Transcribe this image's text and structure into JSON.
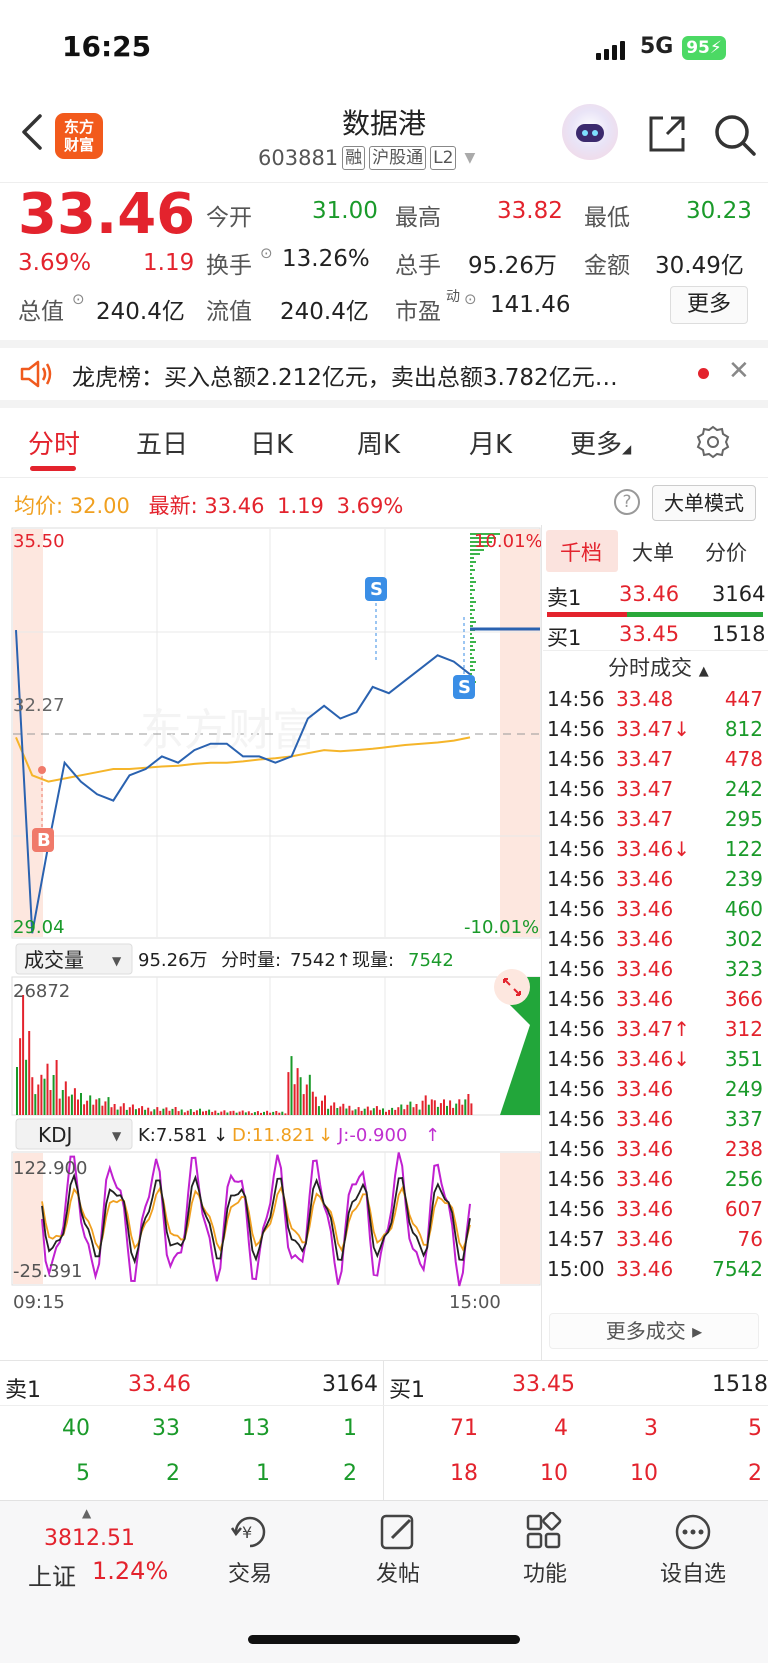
{
  "status": {
    "time": "16:25",
    "network": "5G",
    "battery": "95"
  },
  "header": {
    "logo_text_1": "东方",
    "logo_text_2": "财富",
    "name": "数据港",
    "code": "603881",
    "tags": [
      "融",
      "沪股通",
      "L2"
    ]
  },
  "quote": {
    "price": "33.46",
    "change_pct": "3.69%",
    "change": "1.19",
    "open_label": "今开",
    "open": "31.00",
    "high_label": "最高",
    "high": "33.82",
    "low_label": "最低",
    "low": "30.23",
    "turnover_label": "换手",
    "turnover": "13.26%",
    "volume_label": "总手",
    "volume": "95.26万",
    "amount_label": "金额",
    "amount": "30.49亿",
    "mcap_label": "总值",
    "mcap": "240.4亿",
    "float_label": "流值",
    "float": "240.4亿",
    "pe_label": "市盈",
    "pe_sup": "动",
    "pe": "141.46",
    "more": "更多"
  },
  "dragon": {
    "text": "龙虎榜：买入总额2.212亿元，卖出总额3.782亿元…"
  },
  "tabs": [
    "分时",
    "五日",
    "日K",
    "周K",
    "月K",
    "更多"
  ],
  "info": {
    "avg_label": "均价:",
    "avg": "32.00",
    "last_label": "最新:",
    "last": "33.46",
    "chg": "1.19",
    "pct": "3.69%",
    "big_order": "大单模式"
  },
  "chart_data": {
    "type": "line",
    "title": "",
    "ylim": [
      29.04,
      35.5
    ],
    "prev_close": 32.27,
    "pct_high": "10.01%",
    "pct_low": "-10.01%",
    "y_top_label": "35.50",
    "y_mid_label": "32.27",
    "y_bot_label": "29.04",
    "x_start": "09:15",
    "x_end": "15:00",
    "watermark": "东方财富",
    "series": [
      {
        "values": [
          33.9,
          29.1,
          30.5,
          31.8,
          31.5,
          31.3,
          31.2,
          31.6,
          31.7,
          31.9,
          31.8,
          32.0,
          32.1,
          32.1,
          31.9,
          31.9,
          31.8,
          31.9,
          32.5,
          32.7,
          32.5,
          32.6,
          33.0,
          32.9,
          33.1,
          33.3,
          33.5,
          33.4,
          33.2
        ]
      },
      {
        "values": [
          32.2,
          31.6,
          31.5,
          31.55,
          31.6,
          31.65,
          31.7,
          31.7,
          31.72,
          31.74,
          31.75,
          31.78,
          31.8,
          31.8,
          31.82,
          31.85,
          31.87,
          31.9,
          31.95,
          32.0,
          31.98,
          32.0,
          32.02,
          32.05,
          32.08,
          32.1,
          32.12,
          32.15,
          32.2
        ]
      }
    ],
    "volume_label": "成交量",
    "volume_total": "95.26万",
    "minute_vol_label": "分时量:",
    "minute_vol": "7542",
    "now_vol_label": "现量:",
    "now_vol": "7542",
    "volume_max": "26872",
    "volume_values": [
      26872,
      9000,
      14000,
      8000,
      6000,
      5000,
      4000,
      3000,
      2500,
      2000,
      2000,
      1800,
      1500,
      1500,
      1200,
      1200,
      1000,
      1000,
      1000,
      900,
      15000,
      9000,
      5000,
      3000,
      2500,
      2000,
      2000,
      1800,
      2500,
      3000,
      5000,
      3500,
      4000,
      5000
    ],
    "kdj_label": "KDJ",
    "kdj_k": "K:7.581",
    "kdj_d": "D:11.821",
    "kdj_j": "J:-0.900",
    "kdj_max": "122.900",
    "kdj_min": "-25.391"
  },
  "panel": {
    "tabs": [
      "千档",
      "大单",
      "分价"
    ],
    "sell1_label": "卖1",
    "sell1_price": "33.46",
    "sell1_vol": "3164",
    "buy1_label": "买1",
    "buy1_price": "33.45",
    "buy1_vol": "1518",
    "trades_title": "分时成交",
    "trades": [
      {
        "t": "14:56",
        "p": "33.48",
        "v": "447",
        "c": "red"
      },
      {
        "t": "14:56",
        "p": "33.47↓",
        "v": "812",
        "c": "green"
      },
      {
        "t": "14:56",
        "p": "33.47",
        "v": "478",
        "c": "red"
      },
      {
        "t": "14:56",
        "p": "33.47",
        "v": "242",
        "c": "green"
      },
      {
        "t": "14:56",
        "p": "33.47",
        "v": "295",
        "c": "green"
      },
      {
        "t": "14:56",
        "p": "33.46↓",
        "v": "122",
        "c": "green"
      },
      {
        "t": "14:56",
        "p": "33.46",
        "v": "239",
        "c": "green"
      },
      {
        "t": "14:56",
        "p": "33.46",
        "v": "460",
        "c": "green"
      },
      {
        "t": "14:56",
        "p": "33.46",
        "v": "302",
        "c": "green"
      },
      {
        "t": "14:56",
        "p": "33.46",
        "v": "323",
        "c": "green"
      },
      {
        "t": "14:56",
        "p": "33.46",
        "v": "366",
        "c": "red"
      },
      {
        "t": "14:56",
        "p": "33.47↑",
        "v": "312",
        "c": "red"
      },
      {
        "t": "14:56",
        "p": "33.46↓",
        "v": "351",
        "c": "green"
      },
      {
        "t": "14:56",
        "p": "33.46",
        "v": "249",
        "c": "green"
      },
      {
        "t": "14:56",
        "p": "33.46",
        "v": "337",
        "c": "green"
      },
      {
        "t": "14:56",
        "p": "33.46",
        "v": "238",
        "c": "red"
      },
      {
        "t": "14:56",
        "p": "33.46",
        "v": "256",
        "c": "green"
      },
      {
        "t": "14:56",
        "p": "33.46",
        "v": "607",
        "c": "red"
      },
      {
        "t": "14:57",
        "p": "33.46",
        "v": "76",
        "c": "red"
      },
      {
        "t": "15:00",
        "p": "33.46",
        "v": "7542",
        "c": "green"
      }
    ],
    "more_trades": "更多成交"
  },
  "book": {
    "sell_label": "卖1",
    "sell_price": "33.46",
    "sell_vol": "3164",
    "buy_label": "买1",
    "buy_price": "33.45",
    "buy_vol": "1518",
    "sell_row1": [
      "40",
      "33",
      "13",
      "1"
    ],
    "sell_row2": [
      "5",
      "2",
      "1",
      "2"
    ],
    "buy_row1": [
      "71",
      "4",
      "3",
      "5"
    ],
    "buy_row2": [
      "18",
      "10",
      "10",
      "2"
    ]
  },
  "footer": {
    "index_value": "3812.51",
    "index_name": "上证",
    "index_pct": "1.24%",
    "items": [
      "交易",
      "发帖",
      "功能",
      "设自选"
    ]
  }
}
